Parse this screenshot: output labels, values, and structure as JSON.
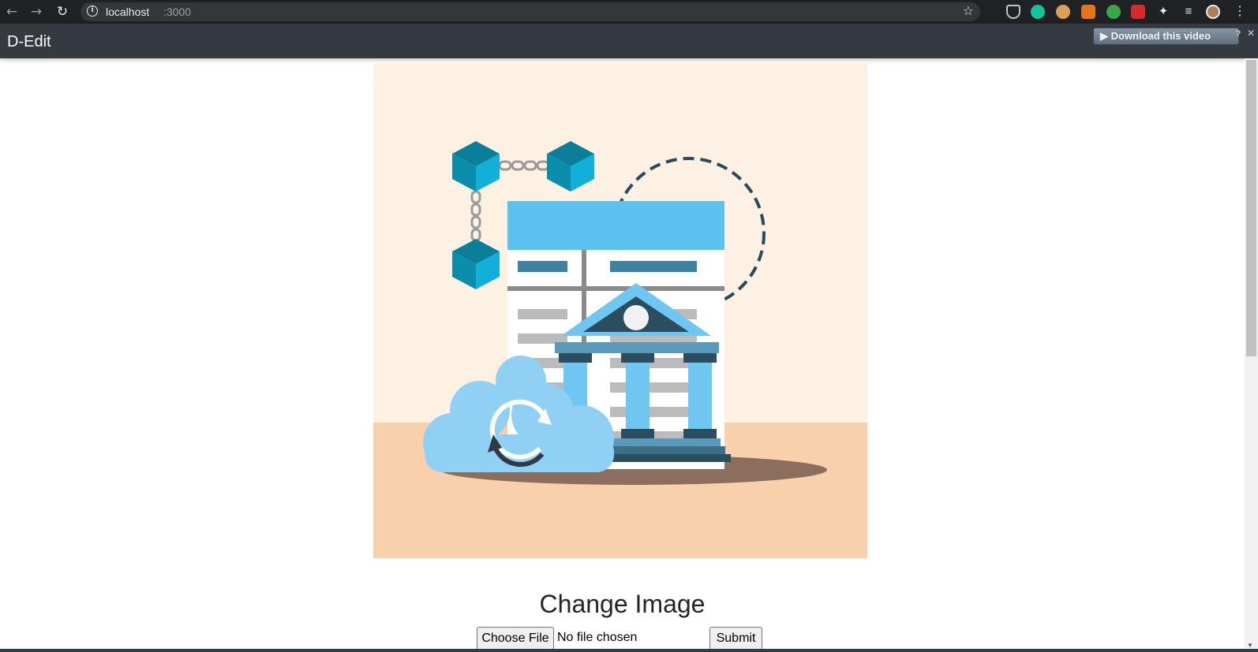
{
  "browser": {
    "url_host": "localhost",
    "url_port": ":3000",
    "icons": [
      "back-icon",
      "forward-icon",
      "reload-icon",
      "info-icon",
      "star-icon",
      "extensions-icon",
      "menu-icon"
    ]
  },
  "header": {
    "brand": "D-Edit"
  },
  "extension_overlay": {
    "download_label": "▶ Download this video",
    "help_label": "?",
    "close_label": "✕"
  },
  "main": {
    "title": "Change Image",
    "choose_file_label": "Choose File",
    "file_status": "No file chosen",
    "submit_label": "Submit"
  },
  "colors": {
    "header_bg": "#343a40",
    "hero_bg_top": "#fdf1e4",
    "hero_bg_bottom": "#f8d1ac",
    "cube_light": "#12b0d8",
    "cube_dark": "#0b7e9a",
    "sheet_header": "#5bc2f0",
    "bank_blue": "#6fc7f1",
    "bank_dark": "#2a4d60",
    "cloud": "#8fd0f4"
  }
}
